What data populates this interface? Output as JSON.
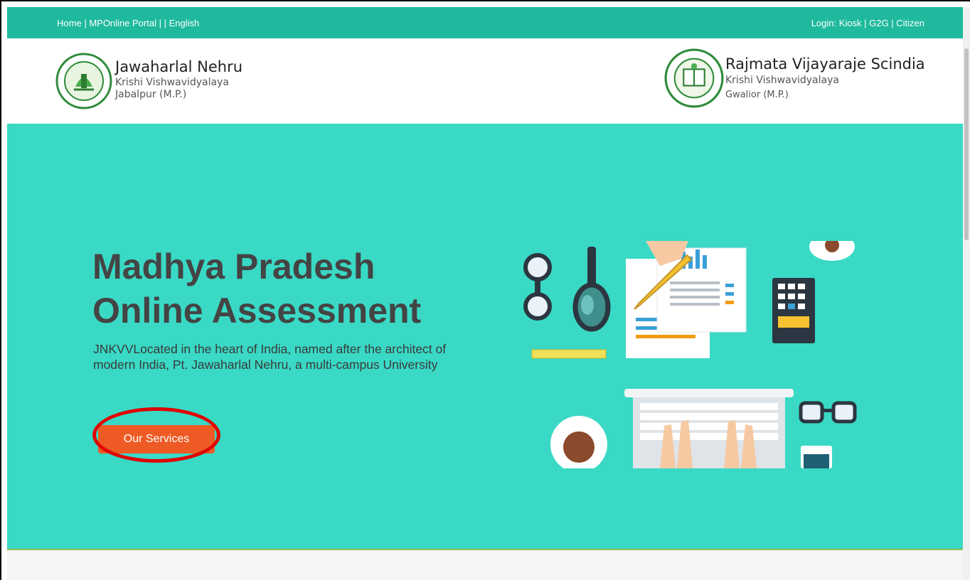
{
  "topbar": {
    "links_left": [
      "Home",
      "MPOnline Portal",
      "English"
    ],
    "login_label": "Login:",
    "links_right": [
      "Kiosk",
      "G2G",
      "Citizen"
    ]
  },
  "header": {
    "left": {
      "title": "Jawaharlal Nehru",
      "sub1": "Krishi Vishwavidyalaya",
      "sub2": "Jabalpur (M.P.)"
    },
    "right": {
      "title": "Rajmata Vijayaraje Scindia",
      "sub1": "Krishi Vishwavidyalaya",
      "sub2": "Gwalior (M.P.)"
    }
  },
  "hero": {
    "title_line1": "Madhya Pradesh",
    "title_line2": "Online Assessment",
    "desc_line1": "JNKVVLocated in the heart of India, named after the architect of",
    "desc_line2": "modern India, Pt. Jawaharlal Nehru, a multi-campus University",
    "cta_label": "Our Services"
  },
  "colors": {
    "topbar": "#1fb99d",
    "hero": "#39d9c5",
    "cta": "#ee5a24",
    "highlight": "#e00000"
  }
}
